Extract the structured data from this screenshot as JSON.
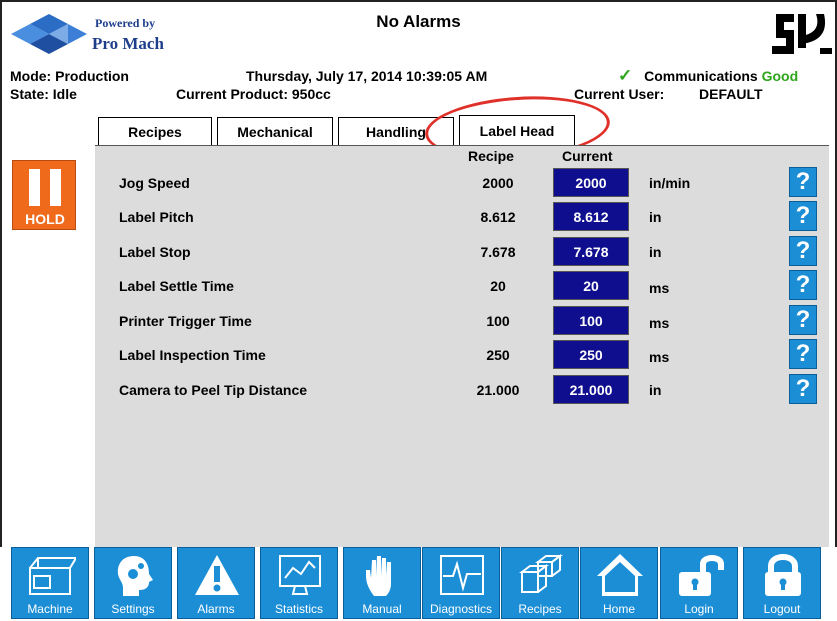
{
  "header": {
    "powered_by": "Powered by",
    "brand": "Pro Mach",
    "alarm_status": "No Alarms",
    "mode": "Mode: Production",
    "state": "State: Idle",
    "datetime": "Thursday, July 17, 2014 10:39:05 AM",
    "current_product": "Current Product: 950cc",
    "communications_label": "Communications",
    "communications_status": "Good",
    "current_user_label": "Current User:",
    "current_user": "DEFAULT",
    "colors": {
      "brand_blue": "#1f3f8c",
      "good_green": "#2ea61c"
    }
  },
  "tabs": [
    {
      "label": "Recipes",
      "active": false
    },
    {
      "label": "Mechanical",
      "active": false
    },
    {
      "label": "Handling",
      "active": false
    },
    {
      "label": "Label Head",
      "active": true
    }
  ],
  "hold_button": {
    "label": "HOLD",
    "icon": "pause-icon",
    "color": "#f06a1c"
  },
  "table": {
    "col_recipe": "Recipe",
    "col_current": "Current",
    "rows": [
      {
        "label": "Jog Speed",
        "recipe": "2000",
        "current": "2000",
        "unit": "in/min"
      },
      {
        "label": "Label Pitch",
        "recipe": "8.612",
        "current": "8.612",
        "unit": "in"
      },
      {
        "label": "Label Stop",
        "recipe": "7.678",
        "current": "7.678",
        "unit": "in"
      },
      {
        "label": "Label Settle Time",
        "recipe": "20",
        "current": "20",
        "unit": "ms"
      },
      {
        "label": "Printer Trigger Time",
        "recipe": "100",
        "current": "100",
        "unit": "ms"
      },
      {
        "label": "Label Inspection Time",
        "recipe": "250",
        "current": "250",
        "unit": "ms"
      },
      {
        "label": "Camera to Peel Tip Distance",
        "recipe": "21.000",
        "current": "21.000",
        "unit": "in"
      }
    ],
    "help_label": "?"
  },
  "nav": [
    {
      "label": "Machine",
      "icon": "machine-icon"
    },
    {
      "label": "Settings",
      "icon": "settings-icon"
    },
    {
      "label": "Alarms",
      "icon": "alarm-icon"
    },
    {
      "label": "Statistics",
      "icon": "statistics-icon"
    },
    {
      "label": "Manual",
      "icon": "hand-icon"
    },
    {
      "label": "Diagnostics",
      "icon": "diagnostics-icon"
    },
    {
      "label": "Recipes",
      "icon": "recipes-icon"
    },
    {
      "label": "Home",
      "icon": "home-icon"
    },
    {
      "label": "Login",
      "icon": "unlock-icon"
    },
    {
      "label": "Logout",
      "icon": "lock-icon"
    }
  ]
}
